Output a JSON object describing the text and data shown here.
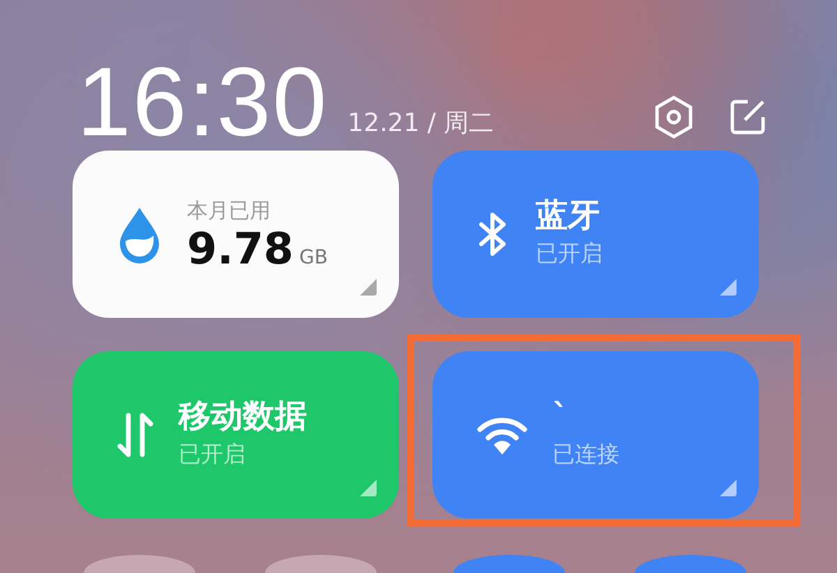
{
  "header": {
    "time": "16:30",
    "date": "12.21 / 周二"
  },
  "tiles": [
    {
      "kind": "usage",
      "label": "本月已用",
      "value": "9.78",
      "unit": "GB"
    },
    {
      "kind": "bluetooth",
      "title": "蓝牙",
      "status": "已开启",
      "on": true,
      "color": "#3f83f5",
      "highlighted": false
    },
    {
      "kind": "cellular",
      "title": "移动数据",
      "status": "已开启",
      "on": true,
      "color": "#1fc76b",
      "highlighted": false
    },
    {
      "kind": "wifi",
      "title": "`",
      "status": "已连接",
      "on": true,
      "color": "#3f83f5",
      "highlighted": true
    }
  ],
  "round_toggles": [
    {
      "on": false
    },
    {
      "on": false
    },
    {
      "on": true
    },
    {
      "on": true
    }
  ]
}
